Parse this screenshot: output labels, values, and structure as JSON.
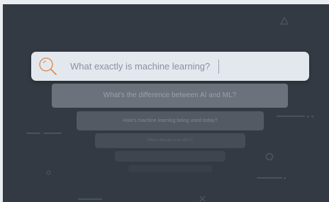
{
  "search": {
    "query": "What exactly is machine learning?",
    "icon": "search-icon"
  },
  "suggestions": [
    "What's the difference between AI and ML?",
    "How's machine learning being used today?",
    "What's data got to do with it?",
    "",
    ""
  ],
  "colors": {
    "background": "#343a43",
    "search_bar": "#e3e8ef",
    "search_icon": "#e0874a"
  }
}
